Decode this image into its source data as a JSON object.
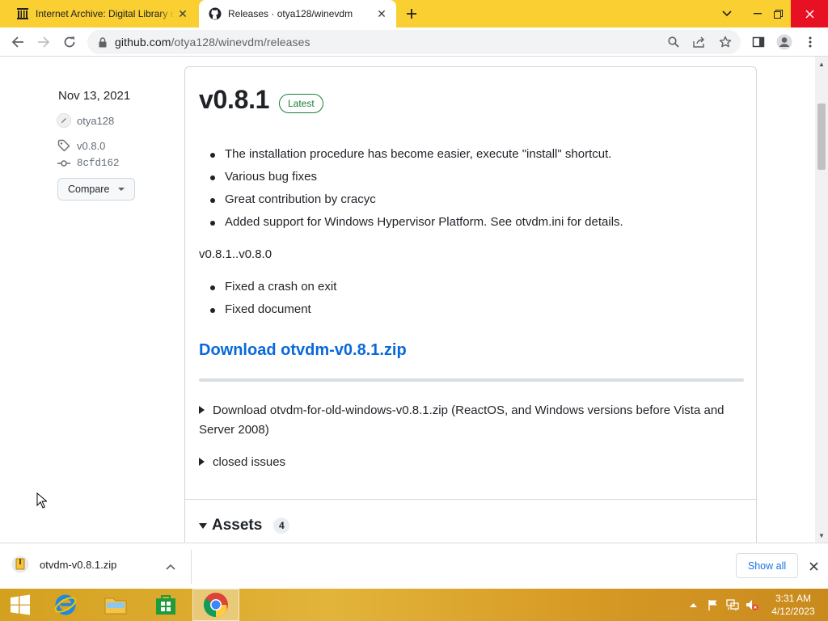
{
  "browser": {
    "tabs": [
      {
        "title": "Internet Archive: Digital Library o",
        "icon": "internet-archive-icon",
        "active": false
      },
      {
        "title": "Releases · otya128/winevdm",
        "icon": "github-icon",
        "active": true
      }
    ],
    "url_host": "github.com",
    "url_path": "/otya128/winevdm/releases",
    "accent": "#f9cf31"
  },
  "sidebar": {
    "date": "Nov 13, 2021",
    "author": "otya128",
    "tag": "v0.8.0",
    "commit": "8cfd162",
    "compare_label": "Compare"
  },
  "release": {
    "title": "v0.8.1",
    "badge": "Latest",
    "notes": [
      "The installation procedure has become easier, execute \"install\" shortcut.",
      "Various bug fixes",
      "Great contribution by cracyc",
      "Added support for Windows Hypervisor Platform. See otvdm.ini for details."
    ],
    "range": "v0.8.1..v0.8.0",
    "range_notes": [
      "Fixed a crash on exit",
      "Fixed document"
    ],
    "download_link": "Download otvdm-v0.8.1.zip",
    "details_old": "Download otvdm-for-old-windows-v0.8.1.zip (ReactOS, and Windows versions before Vista and Server 2008)",
    "details_issues": "closed issues",
    "assets_label": "Assets",
    "assets_count": "4"
  },
  "downloads": {
    "file": "otvdm-v0.8.1.zip",
    "show_all": "Show all"
  },
  "taskbar": {
    "time": "3:31 AM",
    "date": "4/12/2023"
  }
}
